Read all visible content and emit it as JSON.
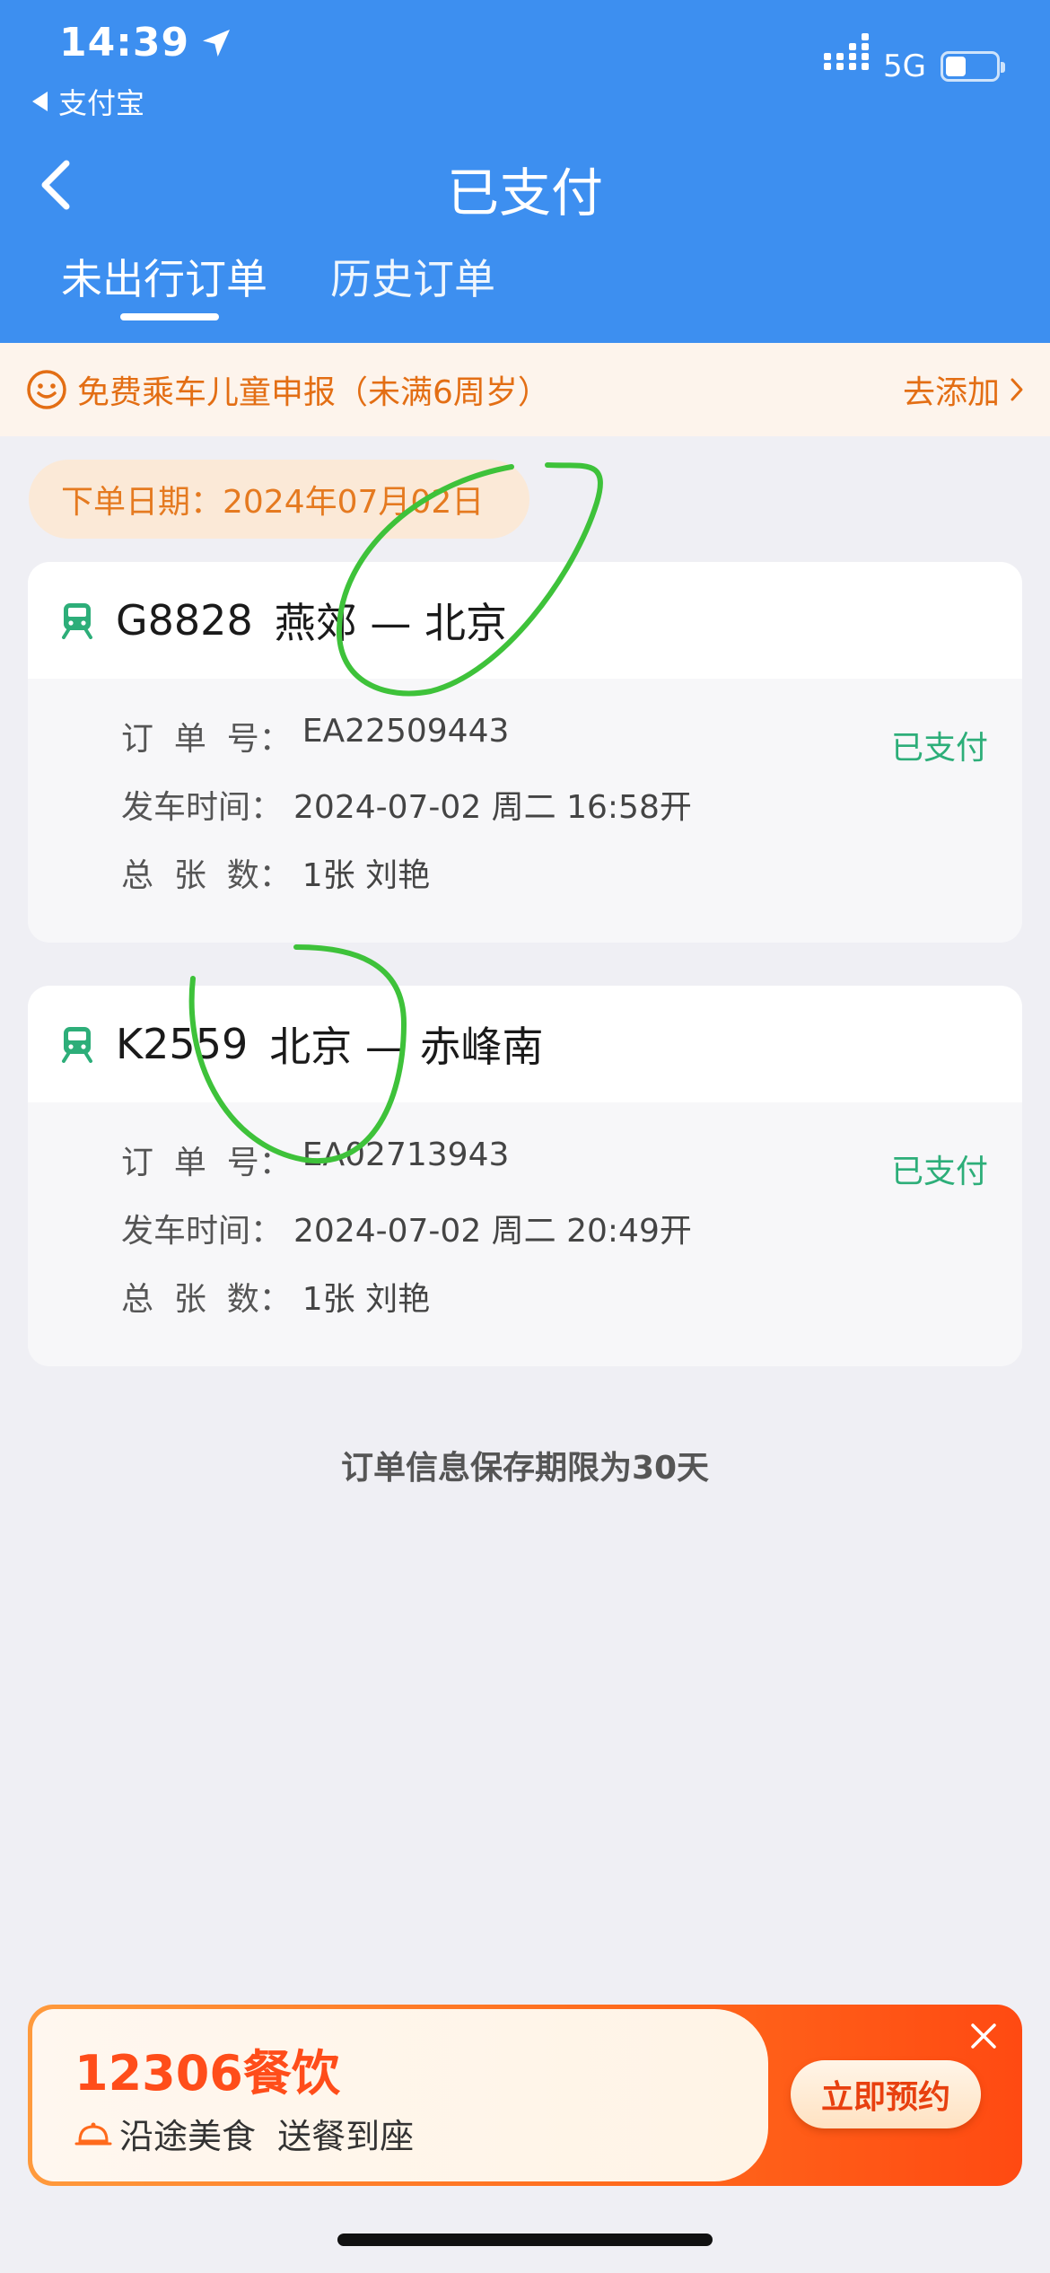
{
  "status_bar": {
    "time": "14:39",
    "back_app": "支付宝",
    "network": "5G",
    "battery_level": 0.4
  },
  "nav": {
    "title": "已支付"
  },
  "tabs": [
    {
      "label": "未出行订单",
      "active": true
    },
    {
      "label": "历史订单",
      "active": false
    }
  ],
  "notice": {
    "text": "免费乘车儿童申报（未满6周岁）",
    "action": "去添加"
  },
  "date_pill": "下单日期：2024年07月02日",
  "labels": {
    "order_no": "订  单  号：",
    "departure": "发车时间：",
    "total": "总  张  数："
  },
  "orders": [
    {
      "train": "G8828",
      "route": "燕郊 — 北京",
      "order_no": "EA22509443",
      "departure": "2024-07-02 周二 16:58开",
      "total": "1张 刘艳",
      "status": "已支付"
    },
    {
      "train": "K2559",
      "route": "北京 — 赤峰南",
      "order_no": "EA02713943",
      "departure": "2024-07-02 周二 20:49开",
      "total": "1张 刘艳",
      "status": "已支付"
    }
  ],
  "retention_note": "订单信息保存期限为30天",
  "banner": {
    "title": "12306餐饮",
    "subtitle": "沿途美食  送餐到座",
    "button": "立即预约"
  },
  "colors": {
    "header_blue": "#3d8ff0",
    "notice_orange": "#e36e14",
    "paid_green": "#2dae79",
    "train_icon_green": "#2dae79",
    "annotation_green": "#3ec23a"
  },
  "icons": [
    "location-arrow-icon",
    "back-chevron-icon",
    "smile-face-icon",
    "chevron-right-icon",
    "train-icon",
    "dish-cover-icon",
    "close-icon"
  ]
}
